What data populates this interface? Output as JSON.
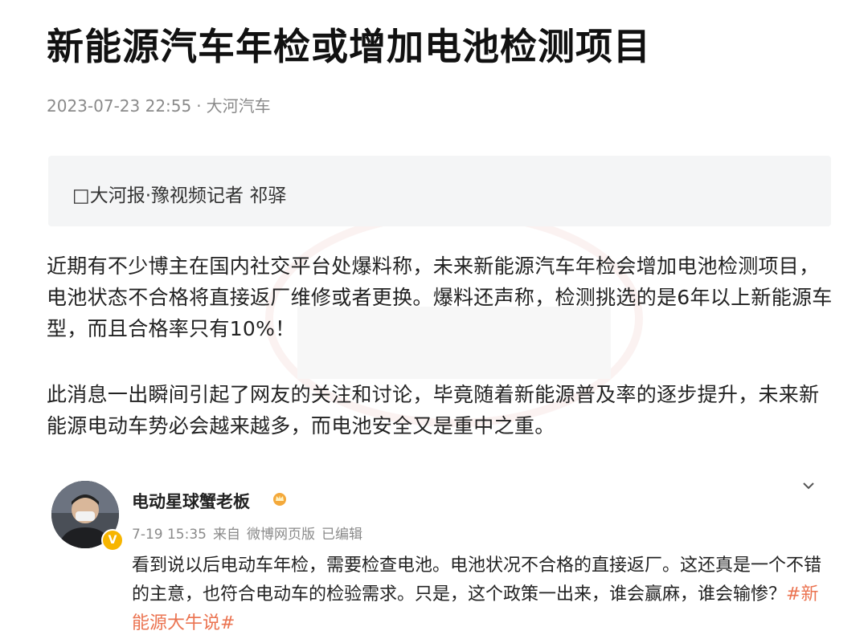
{
  "article": {
    "title": "新能源汽车年检或增加电池检测项目",
    "date": "2023-07-23 22:55",
    "separator": "·",
    "source": "大河汽车",
    "byline": "□大河报·豫视频记者 祁驿",
    "paragraphs": [
      "近期有不少博主在国内社交平台处爆料称，未来新能源汽车年检会增加电池检测项目，电池状态不合格将直接返厂维修或者更换。爆料还声称，检测挑选的是6年以上新能源车型，而且合格率只有10%！",
      "此消息一出瞬间引起了网友的关注和讨论，毕竟随着新能源普及率的逐步提升，未来新能源电动车势必会越来越多，而电池安全又是重中之重。"
    ]
  },
  "weibo_post": {
    "user_name": "电动星球蟹老板",
    "time": "7-19 15:35",
    "from_label": "来自",
    "client": "微博网页版",
    "edited": "已编辑",
    "text": "看到说以后电动车年检，需要检查电池。电池状况不合格的直接返厂。这还真是一个不错的主意，也符合电动车的检验需求。只是，这个政策一出来，谁会赢麻，谁会输惨？",
    "hashtag": "#新能源大牛说#",
    "badge_icon": "verified-v-icon",
    "name_icon": "crown-icon",
    "menu_icon": "chevron-down-icon"
  },
  "colors": {
    "accent_hashtag": "#eb7350",
    "meta_gray": "#8a8a8a",
    "quote_bg": "#f4f5f6",
    "badge_gold": "#f7b500"
  }
}
